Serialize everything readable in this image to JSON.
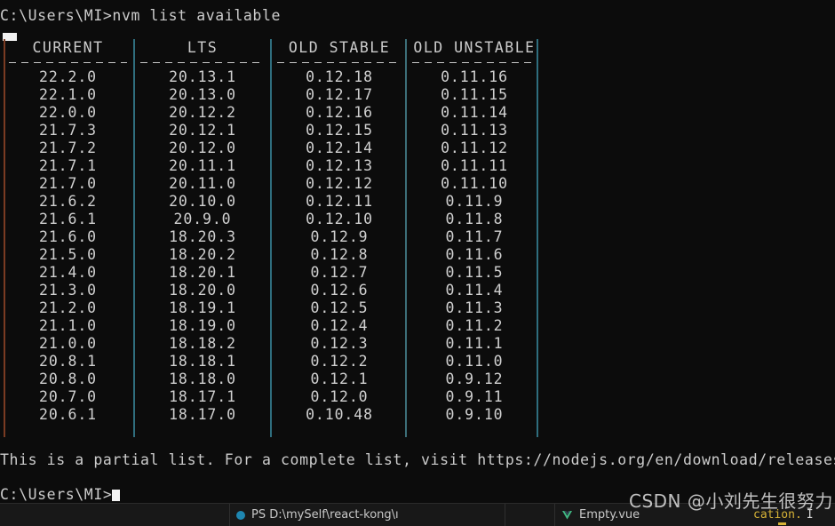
{
  "terminal": {
    "prompt_top": "C:\\Users\\MI>nvm list available",
    "tail_note": "This is a partial list. For a complete list, visit https://nodejs.org/en/download/releases",
    "prompt_bottom": "C:\\Users\\MI>"
  },
  "table": {
    "headers": [
      "CURRENT",
      "LTS",
      "OLD STABLE",
      "OLD UNSTABLE"
    ],
    "columns": {
      "current": [
        "22.2.0",
        "22.1.0",
        "22.0.0",
        "21.7.3",
        "21.7.2",
        "21.7.1",
        "21.7.0",
        "21.6.2",
        "21.6.1",
        "21.6.0",
        "21.5.0",
        "21.4.0",
        "21.3.0",
        "21.2.0",
        "21.1.0",
        "21.0.0",
        "20.8.1",
        "20.8.0",
        "20.7.0",
        "20.6.1"
      ],
      "lts": [
        "20.13.1",
        "20.13.0",
        "20.12.2",
        "20.12.1",
        "20.12.0",
        "20.11.1",
        "20.11.0",
        "20.10.0",
        "20.9.0",
        "18.20.3",
        "18.20.2",
        "18.20.1",
        "18.20.0",
        "18.19.1",
        "18.19.0",
        "18.18.2",
        "18.18.1",
        "18.18.0",
        "18.17.1",
        "18.17.0"
      ],
      "old_stable": [
        "0.12.18",
        "0.12.17",
        "0.12.16",
        "0.12.15",
        "0.12.14",
        "0.12.13",
        "0.12.12",
        "0.12.11",
        "0.12.10",
        "0.12.9",
        "0.12.8",
        "0.12.7",
        "0.12.6",
        "0.12.5",
        "0.12.4",
        "0.12.3",
        "0.12.2",
        "0.12.1",
        "0.12.0",
        "0.10.48"
      ],
      "old_unstable": [
        "0.11.16",
        "0.11.15",
        "0.11.14",
        "0.11.13",
        "0.11.12",
        "0.11.11",
        "0.11.10",
        "0.11.9",
        "0.11.8",
        "0.11.7",
        "0.11.6",
        "0.11.5",
        "0.11.4",
        "0.11.3",
        "0.11.2",
        "0.11.1",
        "0.11.0",
        "0.9.12",
        "0.9.11",
        "0.9.10"
      ]
    }
  },
  "statusbar": {
    "ps_label": "PS D:\\mySelf\\react-kong\\ı",
    "vue_label": "Empty.vue",
    "tail_text": "cation.",
    "tail_letter": "I"
  },
  "watermark": {
    "text": "CSDN @小刘先生很努力"
  },
  "colors": {
    "background": "#0c0c0c",
    "text": "#cccccc",
    "rule_edge": "#7a3b22",
    "rule_inner": "#2f6e7e",
    "statusbar_bg": "#181818",
    "accent_blue": "#1e86b0",
    "accent_green": "#41b883",
    "accent_yellow": "#d7b337"
  }
}
